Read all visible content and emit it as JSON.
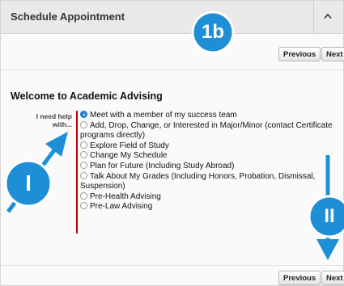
{
  "header": {
    "title": "Schedule Appointment"
  },
  "nav": {
    "previous": "Previous",
    "next": "Next"
  },
  "form": {
    "heading": "Welcome to Academic Advising",
    "label_line1": "I need help",
    "label_line2": "with...",
    "options": [
      {
        "label": "Meet with a member of my success team",
        "selected": true
      },
      {
        "label": "Add, Drop, Change, or Interested in Major/Minor (contact Certificate programs directly)",
        "selected": false
      },
      {
        "label": "Explore Field of Study",
        "selected": false
      },
      {
        "label": "Change My Schedule",
        "selected": false
      },
      {
        "label": "Plan for Future (Including Study Abroad)",
        "selected": false
      },
      {
        "label": "Talk About My Grades (Including Honors, Probation, Dismissal, Suspension)",
        "selected": false
      },
      {
        "label": "Pre-Health Advising",
        "selected": false
      },
      {
        "label": "Pre-Law Advising",
        "selected": false
      }
    ]
  },
  "annotations": {
    "badge_top": "1b",
    "badge_left": "I",
    "badge_right": "II"
  },
  "colors": {
    "annotation_blue": "#1e8fd6",
    "radio_selected": "#2a87e4",
    "required_bar": "#c00000"
  }
}
